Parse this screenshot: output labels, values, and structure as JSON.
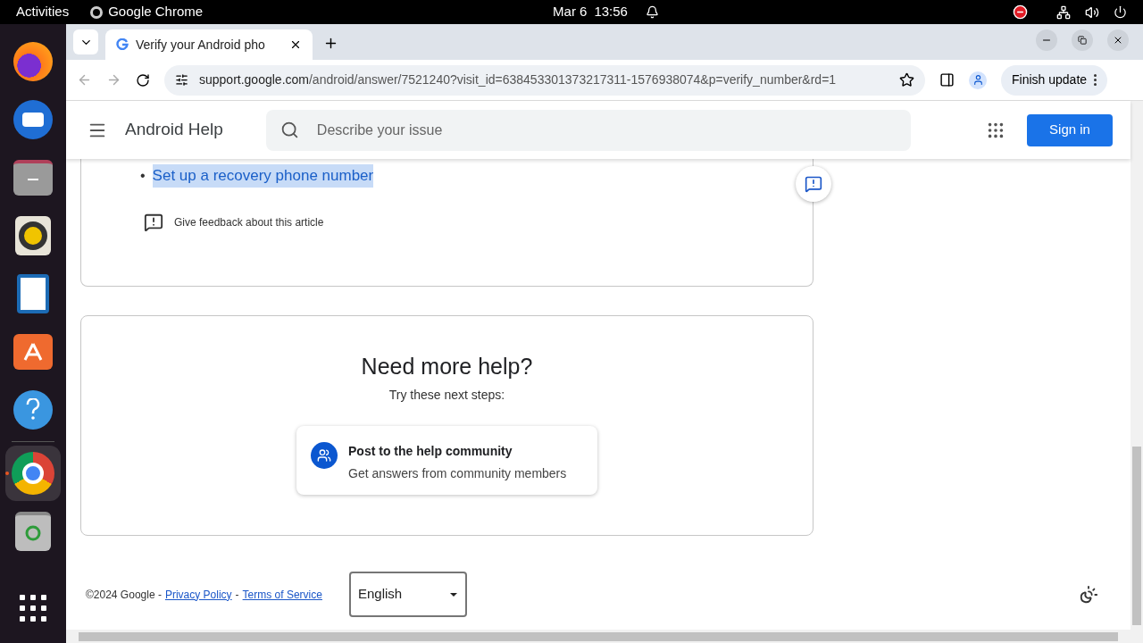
{
  "top_bar": {
    "activities": "Activities",
    "app_name": "Google Chrome",
    "date": "Mar 6",
    "time": "13:56"
  },
  "dock": [
    {
      "kind": "firefox",
      "selected": false
    },
    {
      "kind": "mail",
      "selected": false
    },
    {
      "kind": "files",
      "selected": false
    },
    {
      "kind": "speaker",
      "selected": false
    },
    {
      "kind": "writer",
      "selected": false
    },
    {
      "kind": "store",
      "selected": false
    },
    {
      "kind": "help",
      "selected": false
    },
    {
      "kind": "chrome",
      "selected": true
    },
    {
      "kind": "trash",
      "selected": false
    }
  ],
  "tabs": [
    {
      "title": "Verify your Android pho",
      "selected": true
    }
  ],
  "address": {
    "host": "support.google.com",
    "path": "/android/answer/7521240?visit_id=638453301373217311-1576938074&p=verify_number&rd=1"
  },
  "finish_update": "Finish update",
  "header": {
    "title": "Android Help",
    "search_placeholder": "Describe your issue",
    "sign_in": "Sign in"
  },
  "article": {
    "links": [
      {
        "bullet": "•",
        "text": "Set up a recovery phone number",
        "selected": true
      }
    ],
    "feedback": "Give feedback about this article"
  },
  "help": {
    "title": "Need more help?",
    "subtitle": "Try these next steps:",
    "options": [
      {
        "title": "Post to the help community",
        "subtitle": "Get answers from community members"
      }
    ]
  },
  "footer": {
    "copyright": "©2024 Google -",
    "privacy": "Privacy Policy",
    "separator": "-",
    "terms": "Terms of Service",
    "language": "English"
  }
}
